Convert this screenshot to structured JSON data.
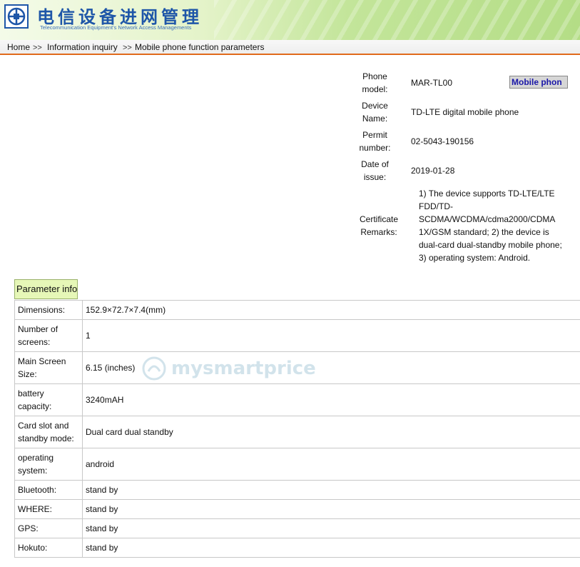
{
  "site": {
    "title": "电信设备进网管理",
    "subtitle": "Telecommunication Equipment's Network Access Managements"
  },
  "breadcrumb": {
    "home": "Home",
    "sep1": ">>",
    "inquiry": "Information inquiry",
    "sep2": ">>",
    "current": "Mobile phone function parameters"
  },
  "device": {
    "phone_model_label": "Phone model:",
    "phone_model": "MAR-TL00",
    "mobile_button": "Mobile phon",
    "device_name_label": "Device Name:",
    "device_name": "TD-LTE digital mobile phone",
    "permit_label": "Permit number:",
    "permit": "02-5043-190156",
    "date_label": "Date of issue:",
    "date": "2019-01-28",
    "remarks_label": "Certificate Remarks:",
    "remarks_lines": [
      "1) The device supports TD-LTE/LTE",
      "FDD/TD-",
      "SCDMA/WCDMA/cdma2000/CDMA",
      "1X/GSM standard; 2) the device is",
      "dual-card dual-standby mobile phone;",
      "3) operating system: Android."
    ]
  },
  "params": {
    "header": "Parameter info",
    "rows": [
      {
        "key": "Dimensions:",
        "value": "152.9×72.7×7.4(mm)"
      },
      {
        "key": "Number of screens:",
        "value": "1"
      },
      {
        "key": "Main Screen Size:",
        "value": "6.15 (inches)"
      },
      {
        "key": "battery capacity:",
        "value": "3240mAH"
      },
      {
        "key": "Card slot and standby mode:",
        "value": "Dual card dual standby"
      },
      {
        "key": "operating system:",
        "value": "android"
      },
      {
        "key": "Bluetooth:",
        "value": "stand by"
      },
      {
        "key": "WHERE:",
        "value": "stand by"
      },
      {
        "key": "GPS:",
        "value": "stand by"
      },
      {
        "key": "Hokuto:",
        "value": "stand by"
      }
    ]
  },
  "watermark": "mysmartprice",
  "colors": {
    "brand_blue": "#1e56a8",
    "breadcrumb_underline": "#e06a1b",
    "param_header_bg": "#e6f7b7",
    "button_text": "#1a17a8"
  }
}
